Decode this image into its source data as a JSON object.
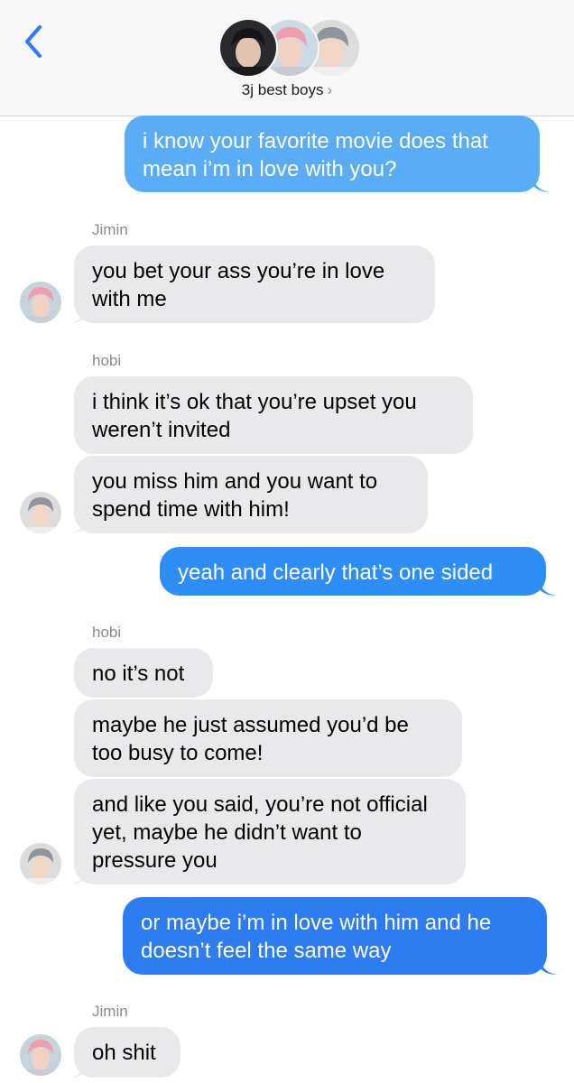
{
  "header": {
    "group_name": "3j best boys",
    "chevron": "›",
    "back_icon": "chevron-left-icon",
    "accent": "#2f7cf6"
  },
  "colors": {
    "sent_bubble": "#2f8ef6",
    "received_bubble": "#e9e9eb",
    "sender_label": "#8a8a8e"
  },
  "messages": [
    {
      "direction": "sent",
      "text": "i know your favorite movie does that mean i’m in love with you?"
    },
    {
      "direction": "received",
      "sender": "Jimin",
      "text": "you bet your ass you’re in love with me"
    },
    {
      "direction": "received",
      "sender": "hobi",
      "text": "i think it’s ok that you’re upset you weren’t invited"
    },
    {
      "direction": "received",
      "text": "you miss him and you want to spend time with him!"
    },
    {
      "direction": "sent",
      "text": "yeah and clearly that’s one sided"
    },
    {
      "direction": "received",
      "sender": "hobi",
      "text": "no it’s not"
    },
    {
      "direction": "received",
      "text": "maybe he just assumed you’d be too busy to come!"
    },
    {
      "direction": "received",
      "text": "and like you said, you’re not official yet, maybe he didn’t want to pressure you"
    },
    {
      "direction": "sent",
      "text": "or maybe i’m in love with him and he doesn’t feel the same way"
    },
    {
      "direction": "received",
      "sender": "Jimin",
      "text": "oh shit"
    }
  ]
}
